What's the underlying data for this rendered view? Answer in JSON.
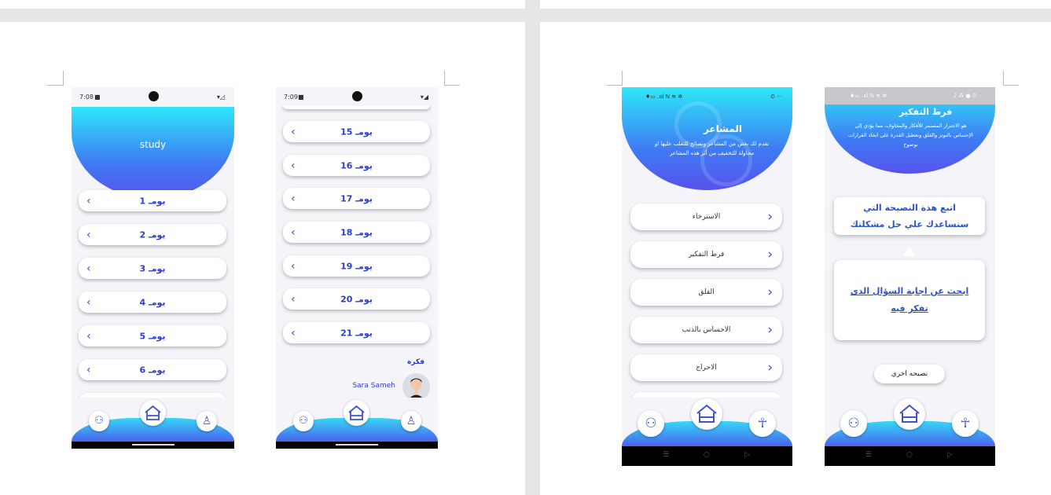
{
  "study_phone": {
    "status": {
      "time": "7:08",
      "right": "▾◿"
    },
    "header_title": "study",
    "days": [
      "يومـ 1",
      "يومـ 2",
      "يومـ 3",
      "يومـ 4",
      "يومـ 5",
      "يومـ 6"
    ]
  },
  "days_phone": {
    "status": {
      "time": "7:09",
      "right": "▾◢"
    },
    "days": [
      "يومـ 15",
      "يومـ 16",
      "يومـ 17",
      "يومـ 18",
      "يومـ 19",
      "يومـ 20",
      "يومـ 21"
    ],
    "idea_label": "فكرة",
    "author_name": "Sara Sameh"
  },
  "feelings_phone": {
    "status": {
      "left": "♦▭ .ııl ℕ ≋ ✲",
      "right": "⏲ ◦ᐧ"
    },
    "title": "المشاعر",
    "description": "نقدم لك بعض من المشاعر ونصائح للتغلب عليها او محاولة للتخفيف من أثر هذه المشاعر",
    "items": [
      "الاسترخاء",
      "فرط التفكير",
      "القلق",
      "الاحساس بالذنب",
      "الاحراج"
    ]
  },
  "overthinking_phone": {
    "status": {
      "left": "♦▭ .ııl ℕ ≋ ✲",
      "right": "♪ ⁂ ● ⏲ ᐧᐧᐧ"
    },
    "title": "فرط التفكير",
    "description": "هو الاجترار المستمر للأفكار والمخاوف، مما يؤدي إلى الإحساس بالتوتر والقلق وتعطيل القدرة على اتخاذ القرارات بوضوح",
    "advice_line1": "اتبع هذة النصيحة التي",
    "advice_line2": "ستساعدك علي حل مشكلتك",
    "tip_line1": "ابحث عن اجابة السؤال الذى",
    "tip_line2": "تفكر فيه",
    "other_advice_button": "نصيحه اخري"
  },
  "android_nav": {
    "menu": "☰",
    "home": "○",
    "back": "▷"
  },
  "colors": {
    "accent": "#3e6cf0",
    "cyan": "#2ee8f8",
    "text_blue": "#2d3bd6"
  }
}
